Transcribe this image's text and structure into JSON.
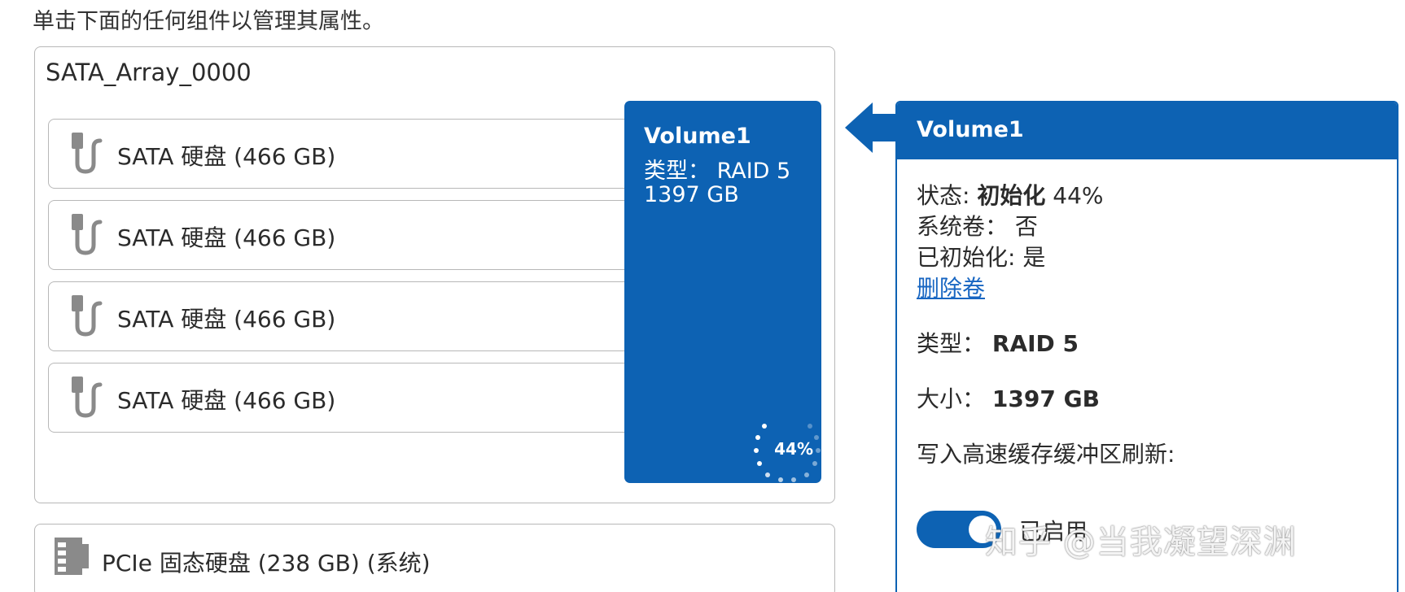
{
  "instruction": "单击下面的任何组件以管理其属性。",
  "array": {
    "name": "SATA_Array_0000",
    "disks": [
      {
        "label": "SATA 硬盘 (466 GB)",
        "icon": "sata-cable-icon"
      },
      {
        "label": "SATA 硬盘 (466 GB)",
        "icon": "sata-cable-icon"
      },
      {
        "label": "SATA 硬盘 (466 GB)",
        "icon": "sata-cable-icon"
      },
      {
        "label": "SATA 硬盘 (466 GB)",
        "icon": "sata-cable-icon"
      }
    ]
  },
  "volume_block": {
    "name": "Volume1",
    "type": "类型： RAID 5",
    "size": "1397 GB",
    "progress_text": "44%",
    "progress": 0.44
  },
  "pcie": {
    "label": "PCIe 固态硬盘 (238 GB) (系统)",
    "icon": "ssd-icon"
  },
  "detail": {
    "title": "Volume1",
    "status_label": "状态: ",
    "status_value": "初始化",
    "status_percent": " 44%",
    "system_volume": "系统卷： 否",
    "initialized": "已初始化: 是",
    "delete_link": "删除卷",
    "type_label": "类型： ",
    "type_value": "RAID 5",
    "size_label": "大小： ",
    "size_value": "1397 GB",
    "write_cache_label": "写入高速缓存缓冲区刷新:",
    "toggle_label": "已启用",
    "toggle_on": true
  },
  "watermark": "知乎 @当我凝望深渊",
  "colors": {
    "accent": "#0d62b3",
    "border": "#b8b8b8",
    "link": "#1866c2"
  }
}
